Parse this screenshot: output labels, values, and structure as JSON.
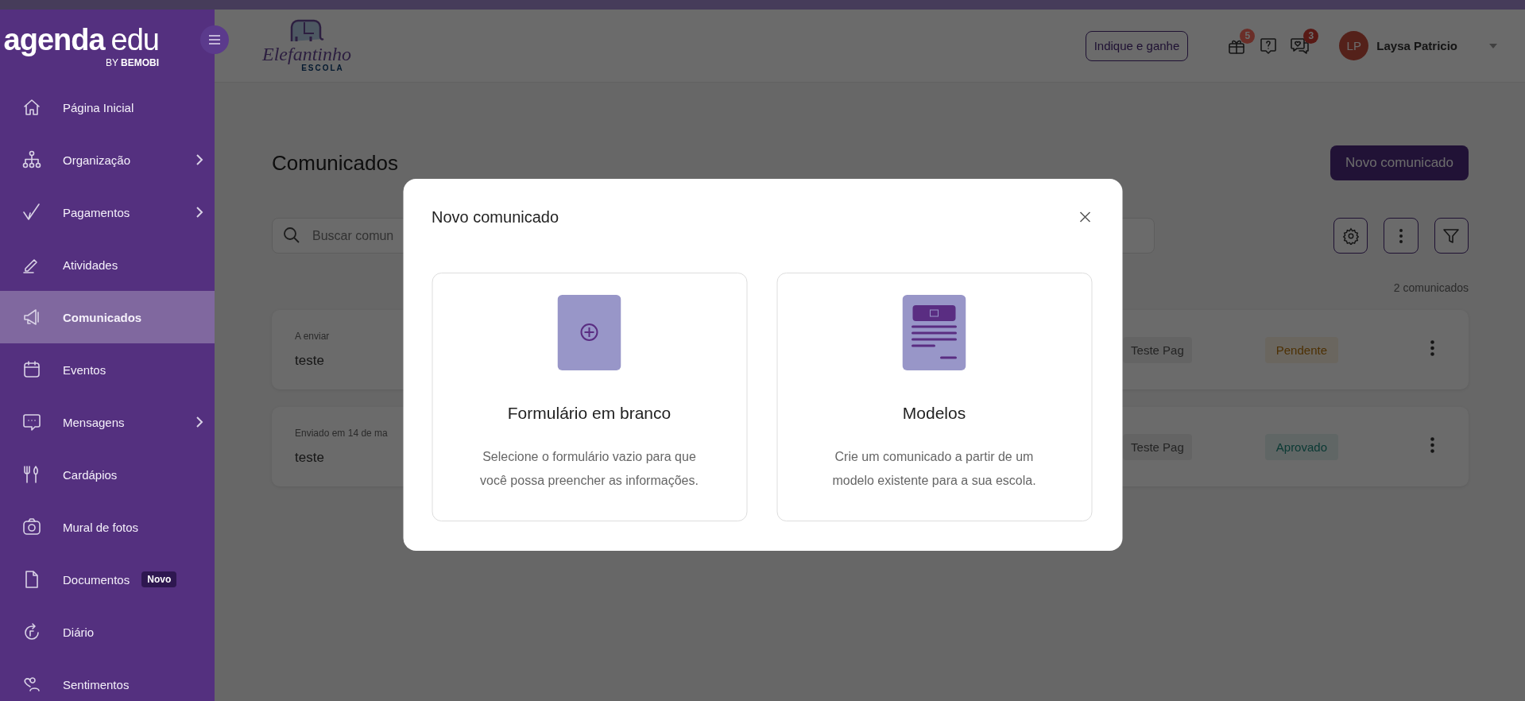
{
  "sidebar": {
    "logo": {
      "name": "agenda",
      "suffix": "edu",
      "byline": "BY **BEMOBI**"
    },
    "items": [
      {
        "label": "Página Inicial",
        "selected": false,
        "expandable": false
      },
      {
        "label": "Organização",
        "selected": false,
        "expandable": true
      },
      {
        "label": "Pagamentos",
        "selected": false,
        "expandable": true
      },
      {
        "label": "Atividades",
        "selected": false,
        "expandable": false
      },
      {
        "label": "Comunicados",
        "selected": true,
        "expandable": false
      },
      {
        "label": "Eventos",
        "selected": false,
        "expandable": false
      },
      {
        "label": "Mensagens",
        "selected": false,
        "expandable": true
      },
      {
        "label": "Cardápios",
        "selected": false,
        "expandable": false
      },
      {
        "label": "Mural de fotos",
        "selected": false,
        "expandable": false
      },
      {
        "label": "Documentos",
        "selected": false,
        "expandable": false,
        "badge": "Novo"
      },
      {
        "label": "Diário",
        "selected": false,
        "expandable": false
      },
      {
        "label": "Sentimentos",
        "selected": false,
        "expandable": false
      }
    ]
  },
  "header": {
    "school": {
      "name": "Elefantinho",
      "subtitle": "ESCOLA"
    },
    "referral_button": "Indique e ganhe",
    "icons": [
      {
        "badge": "5",
        "kind": "light"
      },
      {
        "kind": "none"
      },
      {
        "badge": "3",
        "kind": "dark"
      }
    ],
    "user": {
      "initials": "LP",
      "name": "Laysa Patricio"
    }
  },
  "page": {
    "title": "Comunicados",
    "new_button": "Novo comunicado",
    "search": {
      "placeholder": "Buscar comun"
    },
    "count": "2 comunicados",
    "rows": [
      {
        "label": "A enviar",
        "title": "teste",
        "tag": "Teste Pag",
        "status": {
          "label": "Pendente",
          "kind": "pending"
        }
      },
      {
        "label": "Enviado em 14 de ma",
        "title": "teste",
        "tag": "Teste Pag",
        "status": {
          "label": "Aprovado",
          "kind": "approved"
        }
      }
    ]
  },
  "modal": {
    "title": "Novo comunicado",
    "options": [
      {
        "kind": "blank",
        "title": "Formulário em branco",
        "description": "Selecione o formulário vazio para que você possa preencher as informações."
      },
      {
        "kind": "template",
        "title": "Modelos",
        "description": "Crie um comunicado a partir de um modelo existente para a sua escola."
      }
    ]
  }
}
